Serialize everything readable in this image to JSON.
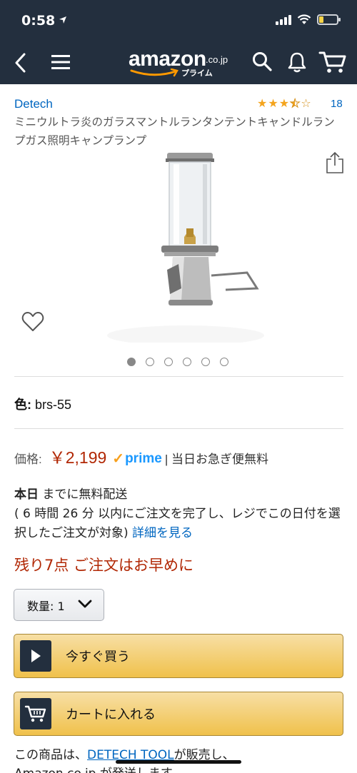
{
  "status_bar": {
    "time": "0:58",
    "battery_level": 0.25,
    "battery_color": "#f7d347"
  },
  "nav": {
    "logo_text": "amazon",
    "logo_domain": ".co.jp",
    "logo_sub": "プライム",
    "icons": [
      "back-icon",
      "menu-icon",
      "search-icon",
      "bell-icon",
      "cart-icon"
    ],
    "bar_color": "#232f3e"
  },
  "product": {
    "brand": "Detech",
    "rating": 3.5,
    "review_count": "18",
    "title": "ミニウルトラ炎のガラスマントルランタンテントキャンドルランプガス照明キャンプランプ",
    "image_count": 6,
    "active_image": 1
  },
  "color": {
    "label": "色:",
    "value": "brs-55"
  },
  "price": {
    "label": "価格:",
    "value": "￥2,199",
    "prime_label": "prime",
    "shipping": "| 当日お急ぎ便無料",
    "price_color": "#b12704"
  },
  "delivery": {
    "bold": "本日",
    "text1": " までに無料配送",
    "text2": "( 6 時間 26 分 以内にご注文を完了し、レジでこの日付を選択したご注文が対象) ",
    "link": "詳細を見る"
  },
  "stock": {
    "text": "残り7点 ご注文はお早めに"
  },
  "quantity": {
    "label": "数量: 1"
  },
  "buttons": {
    "buy_now": "今すぐ買う",
    "add_to_cart": "カートに入れる",
    "button_color": "#f0c14b"
  },
  "seller": {
    "prefix": "この商品は、",
    "name": "DETECH TOOL",
    "suffix": "が販売し、",
    "line2": "Amazon.co.jp が発送します。"
  }
}
